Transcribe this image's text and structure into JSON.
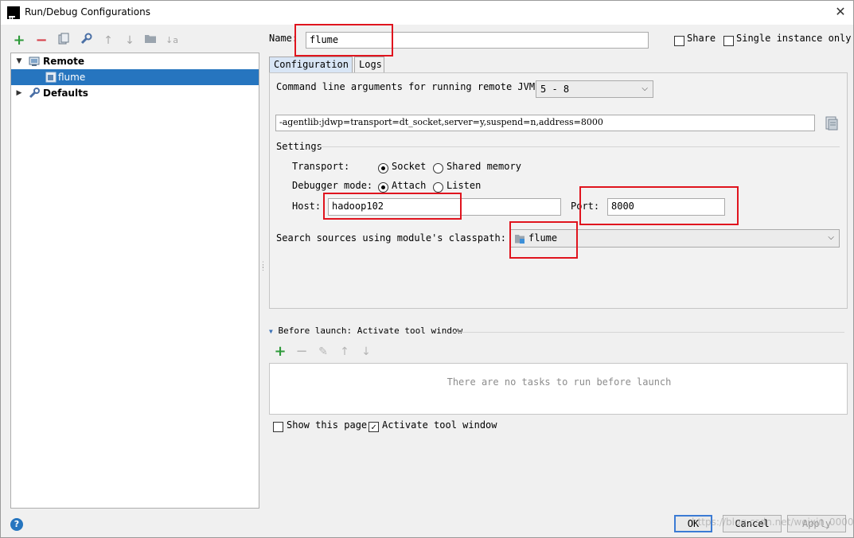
{
  "window": {
    "title": "Run/Debug Configurations",
    "app_icon_text": "IJ"
  },
  "toolbar": {
    "add": "+",
    "remove": "−",
    "copy": "⧉",
    "edit_defaults": "🔧",
    "move_up": "↑",
    "move_down": "↓",
    "folder": "▬",
    "sort": "↓a"
  },
  "tree": {
    "nodes": [
      {
        "label": "Remote",
        "expanded": true,
        "bold": true
      },
      {
        "label": "flume",
        "selected": true
      },
      {
        "label": "Defaults",
        "expanded": false,
        "bold": true
      }
    ]
  },
  "name_field": {
    "label": "Name:",
    "value": "flume"
  },
  "share": {
    "label": "Share",
    "checked": false
  },
  "single_instance": {
    "label": "Single instance only",
    "checked": false
  },
  "tabs": [
    {
      "label": "Configuration",
      "active": true
    },
    {
      "label": "Logs",
      "active": false
    }
  ],
  "configuration": {
    "cmd_args_label": "Command line arguments for running remote JVM",
    "jvm_version": "5 - 8",
    "cmd_args_value": "-agentlib:jdwp=transport=dt_socket,server=y,suspend=n,address=8000",
    "settings_label": "Settings",
    "transport_label": "Transport:",
    "transport_options": [
      {
        "label": "Socket",
        "selected": true
      },
      {
        "label": "Shared memory",
        "selected": false
      }
    ],
    "debugger_mode_label": "Debugger mode:",
    "debugger_mode_options": [
      {
        "label": "Attach",
        "selected": true
      },
      {
        "label": "Listen",
        "selected": false
      }
    ],
    "host_label": "Host:",
    "host_value": "hadoop102",
    "port_label": "Port:",
    "port_value": "8000",
    "classpath_label": "Search sources using module's classpath:",
    "classpath_value": "flume"
  },
  "before_launch": {
    "label": "Before launch: Activate tool window",
    "empty_text": "There are no tasks to run before launch",
    "show_this_page": {
      "label": "Show this page",
      "checked": false
    },
    "activate_tool_window": {
      "label": "Activate tool window",
      "checked": true
    }
  },
  "buttons": {
    "ok": "OK",
    "cancel": "Cancel",
    "apply": "Apply"
  },
  "help_icon": "?",
  "watermark": "https://blog.csdn.net/weixin_0000"
}
